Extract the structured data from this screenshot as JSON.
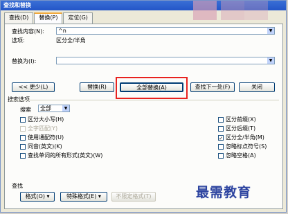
{
  "window": {
    "title": "查找和替换"
  },
  "tabs": [
    {
      "label": "查找(D)",
      "active": false
    },
    {
      "label": "替换(P)",
      "active": true
    },
    {
      "label": "定位(G)",
      "active": false
    }
  ],
  "find": {
    "label": "查找内容(N):",
    "value": "^n",
    "options_label": "选项:",
    "options_value": "区分全/半角"
  },
  "replace": {
    "label": "替换为(I):",
    "value": ""
  },
  "buttons": {
    "less": "<< 更少(L)",
    "replace": "替换(R)",
    "replace_all": "全部替换(A)",
    "find_next": "查找下一处(F)",
    "close": "关闭"
  },
  "search_options": {
    "legend": "搜索选项",
    "search_label": "搜索",
    "search_value": "全部",
    "left": [
      {
        "label": "区分大小写(H)",
        "checked": false,
        "enabled": true
      },
      {
        "label": "全字匹配(Y)",
        "checked": false,
        "enabled": false
      },
      {
        "label": "使用通配符(U)",
        "checked": false,
        "enabled": true
      },
      {
        "label": "同音(英文)(K)",
        "checked": false,
        "enabled": true
      },
      {
        "label": "查找单词的所有形式(英文)(W)",
        "checked": false,
        "enabled": true
      }
    ],
    "right": [
      {
        "label": "区分前缀(X)",
        "checked": false,
        "enabled": true
      },
      {
        "label": "区分后缀(T)",
        "checked": false,
        "enabled": true
      },
      {
        "label": "区分全/半角(M)",
        "checked": true,
        "enabled": true
      },
      {
        "label": "忽略标点符号(S)",
        "checked": false,
        "enabled": true
      },
      {
        "label": "忽略空格(A)",
        "checked": false,
        "enabled": true
      }
    ]
  },
  "bottom": {
    "section_label": "查找",
    "format": "格式(O) ▾",
    "special": "特殊格式(E) ▾",
    "no_format": "不限定格式(T)"
  },
  "watermark": "最需教育"
}
